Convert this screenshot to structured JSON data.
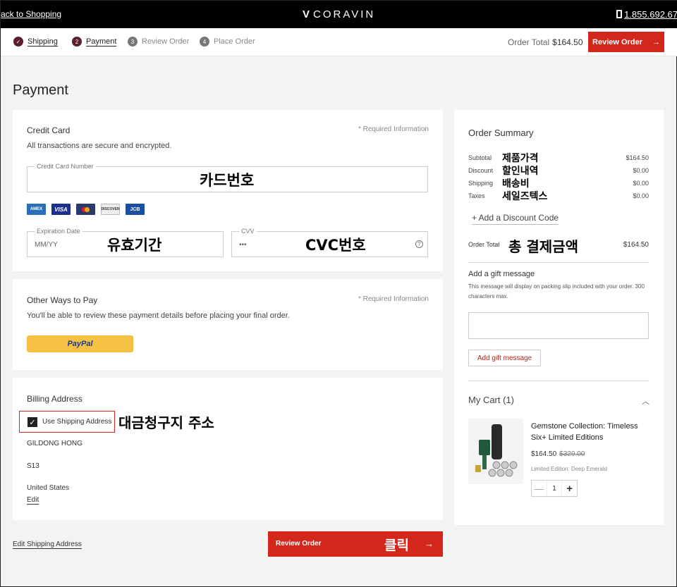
{
  "topbar": {
    "back_label": "ack to Shopping",
    "logo": "CORAVIN",
    "phone": "1.855.692.67"
  },
  "steps": [
    {
      "num": "✓",
      "label": "Shipping"
    },
    {
      "num": "2",
      "label": "Payment"
    },
    {
      "num": "3",
      "label": "Review Order"
    },
    {
      "num": "4",
      "label": "Place Order"
    }
  ],
  "header": {
    "order_total_label": "Order Total",
    "order_total_value": "$164.50",
    "review_label": "Review Order",
    "review_arrow": "→"
  },
  "page_title": "Payment",
  "credit_card": {
    "title": "Credit Card",
    "required": "* Required Information",
    "secure_note": "All transactions are secure and encrypted.",
    "number_label": "Credit Card Number",
    "number_annotation": "카드번호",
    "expiration_label": "Expiration Date",
    "expiration_placeholder": "MM/YY",
    "expiration_annotation": "유효기간",
    "cvv_label": "CVV",
    "cvv_placeholder": "•••",
    "cvv_annotation": "CVC번호",
    "help": "?",
    "logos": [
      "AMERICAN EXPRESS",
      "VISA",
      "mastercard",
      "DISCOVER",
      "JCB"
    ]
  },
  "other_pay": {
    "title": "Other Ways to Pay",
    "required": "* Required Information",
    "note": "You'll be able to review these payment details before placing your final order.",
    "paypal_label": "PayPal"
  },
  "billing": {
    "title": "Billing Address",
    "checkbox_label": "Use Shipping Address",
    "checkbox_mark": "✓",
    "annotation": "대금청구지 주소",
    "name": "GILDONG HONG",
    "line1": "S13",
    "country": "United States",
    "edit_label": "Edit"
  },
  "footer": {
    "edit_shipping": "Edit Shipping Address",
    "review_label": "Review Order",
    "click_annotation": "클릭",
    "arrow": "→"
  },
  "summary": {
    "title": "Order Summary",
    "rows": [
      {
        "label": "Subtotal",
        "annotation": "제품가격",
        "value": "$164.50"
      },
      {
        "label": "Discount",
        "annotation": "할인내역",
        "value": "$0.00"
      },
      {
        "label": "Shipping",
        "annotation": "배송비",
        "value": "$0.00"
      },
      {
        "label": "Taxes",
        "annotation": "세일즈텍스",
        "value": "$0.00"
      }
    ],
    "discount_link": "+ Add a Discount Code",
    "total_label": "Order Total",
    "total_annotation": "총 결제금액",
    "total_value": "$164.50",
    "gift_title": "Add a gift message",
    "gift_desc": "This message will display on packing slip included with your order. 300 characters max.",
    "gift_button": "Add gift message",
    "cart_title": "My Cart",
    "cart_count": "(1)",
    "chevron": "︿",
    "product": {
      "name": "Gemstone Collection: Timeless Six+ Limited Editions",
      "price": "$164.50",
      "old_price": "$329.00",
      "variant": "Limited Edition: Deep Emerald",
      "qty": "1",
      "minus": "—",
      "plus": "+"
    }
  }
}
